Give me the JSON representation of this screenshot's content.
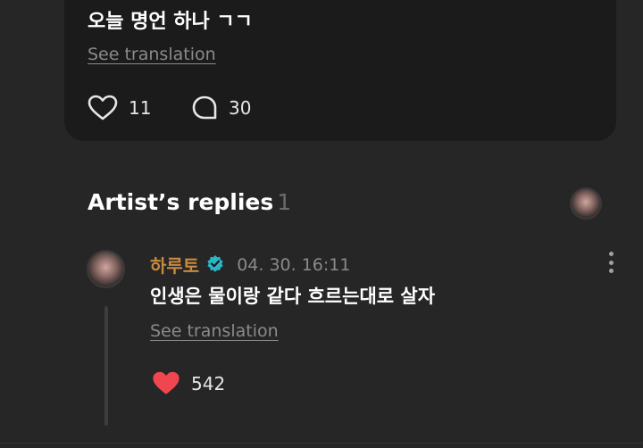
{
  "post": {
    "text": "오늘 명언 하나 ㄱㄱ",
    "see_translation": "See translation",
    "like_count": "11",
    "comment_count": "30"
  },
  "artist_replies": {
    "title": "Artist’s replies",
    "count": "1"
  },
  "reply": {
    "author": "하루토",
    "date": "04. 30. 16:11",
    "text": "인생은 물이랑 같다 흐르는대로 살자",
    "see_translation": "See translation",
    "like_count": "542"
  },
  "colors": {
    "background": "#262626",
    "card": "#1b1b1b",
    "author_name": "#c98a3c",
    "verified_badge": "#29b6c8",
    "liked_heart": "#f0464f"
  },
  "icons": {
    "post_like": "heart-outline-icon",
    "post_comment": "speech-bubble-icon",
    "verified": "verified-badge-icon",
    "reply_like": "heart-filled-icon",
    "more": "more-vertical-icon"
  }
}
